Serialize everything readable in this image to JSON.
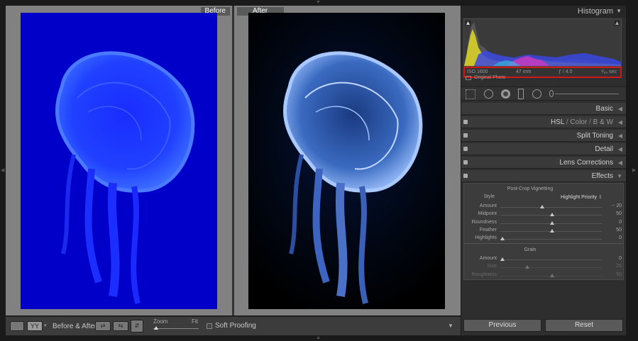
{
  "before_label": "Before",
  "after_label": "After",
  "toolbar": {
    "view_label": "YY",
    "before_after_label": "Before & After :",
    "zoom_label": "Zoom",
    "zoom_value": "Fit",
    "soft_proofing": "Soft Proofing"
  },
  "histogram": {
    "title": "Histogram",
    "iso": "ISO 1600",
    "focal": "47 mm",
    "aperture": "ƒ / 4.0",
    "shutter": "¹⁄₆₀ sec",
    "original_photo": "Original Photo"
  },
  "sections": {
    "basic": "Basic",
    "hsl": "HSL",
    "color": "Color",
    "bw": "B & W",
    "split_toning": "Split Toning",
    "detail": "Detail",
    "lens_corrections": "Lens Corrections",
    "effects": "Effects"
  },
  "effects": {
    "vignetting_title": "Post-Crop Vignetting",
    "style_label": "Style",
    "style_value": "Highlight Priority",
    "grain_title": "Grain",
    "vignette_sliders": [
      {
        "label": "Amount",
        "value": "− 20",
        "level": 0.4
      },
      {
        "label": "Midpoint",
        "value": "50",
        "level": 0.5
      },
      {
        "label": "Roundness",
        "value": "0",
        "level": 0.5
      },
      {
        "label": "Feather",
        "value": "50",
        "level": 0.5
      },
      {
        "label": "Highlights",
        "value": "0",
        "level": 0.0
      }
    ],
    "grain_sliders": [
      {
        "label": "Amount",
        "value": "0",
        "level": 0.0
      },
      {
        "label": "Size",
        "value": "25",
        "level": 0.25
      },
      {
        "label": "Roughness",
        "value": "50",
        "level": 0.5
      }
    ]
  },
  "buttons": {
    "previous": "Previous",
    "reset": "Reset"
  },
  "colors": {
    "before_photo_bg": "#0000c8",
    "after_photo_bg": "#000000",
    "highlight_box": "#d01818"
  }
}
